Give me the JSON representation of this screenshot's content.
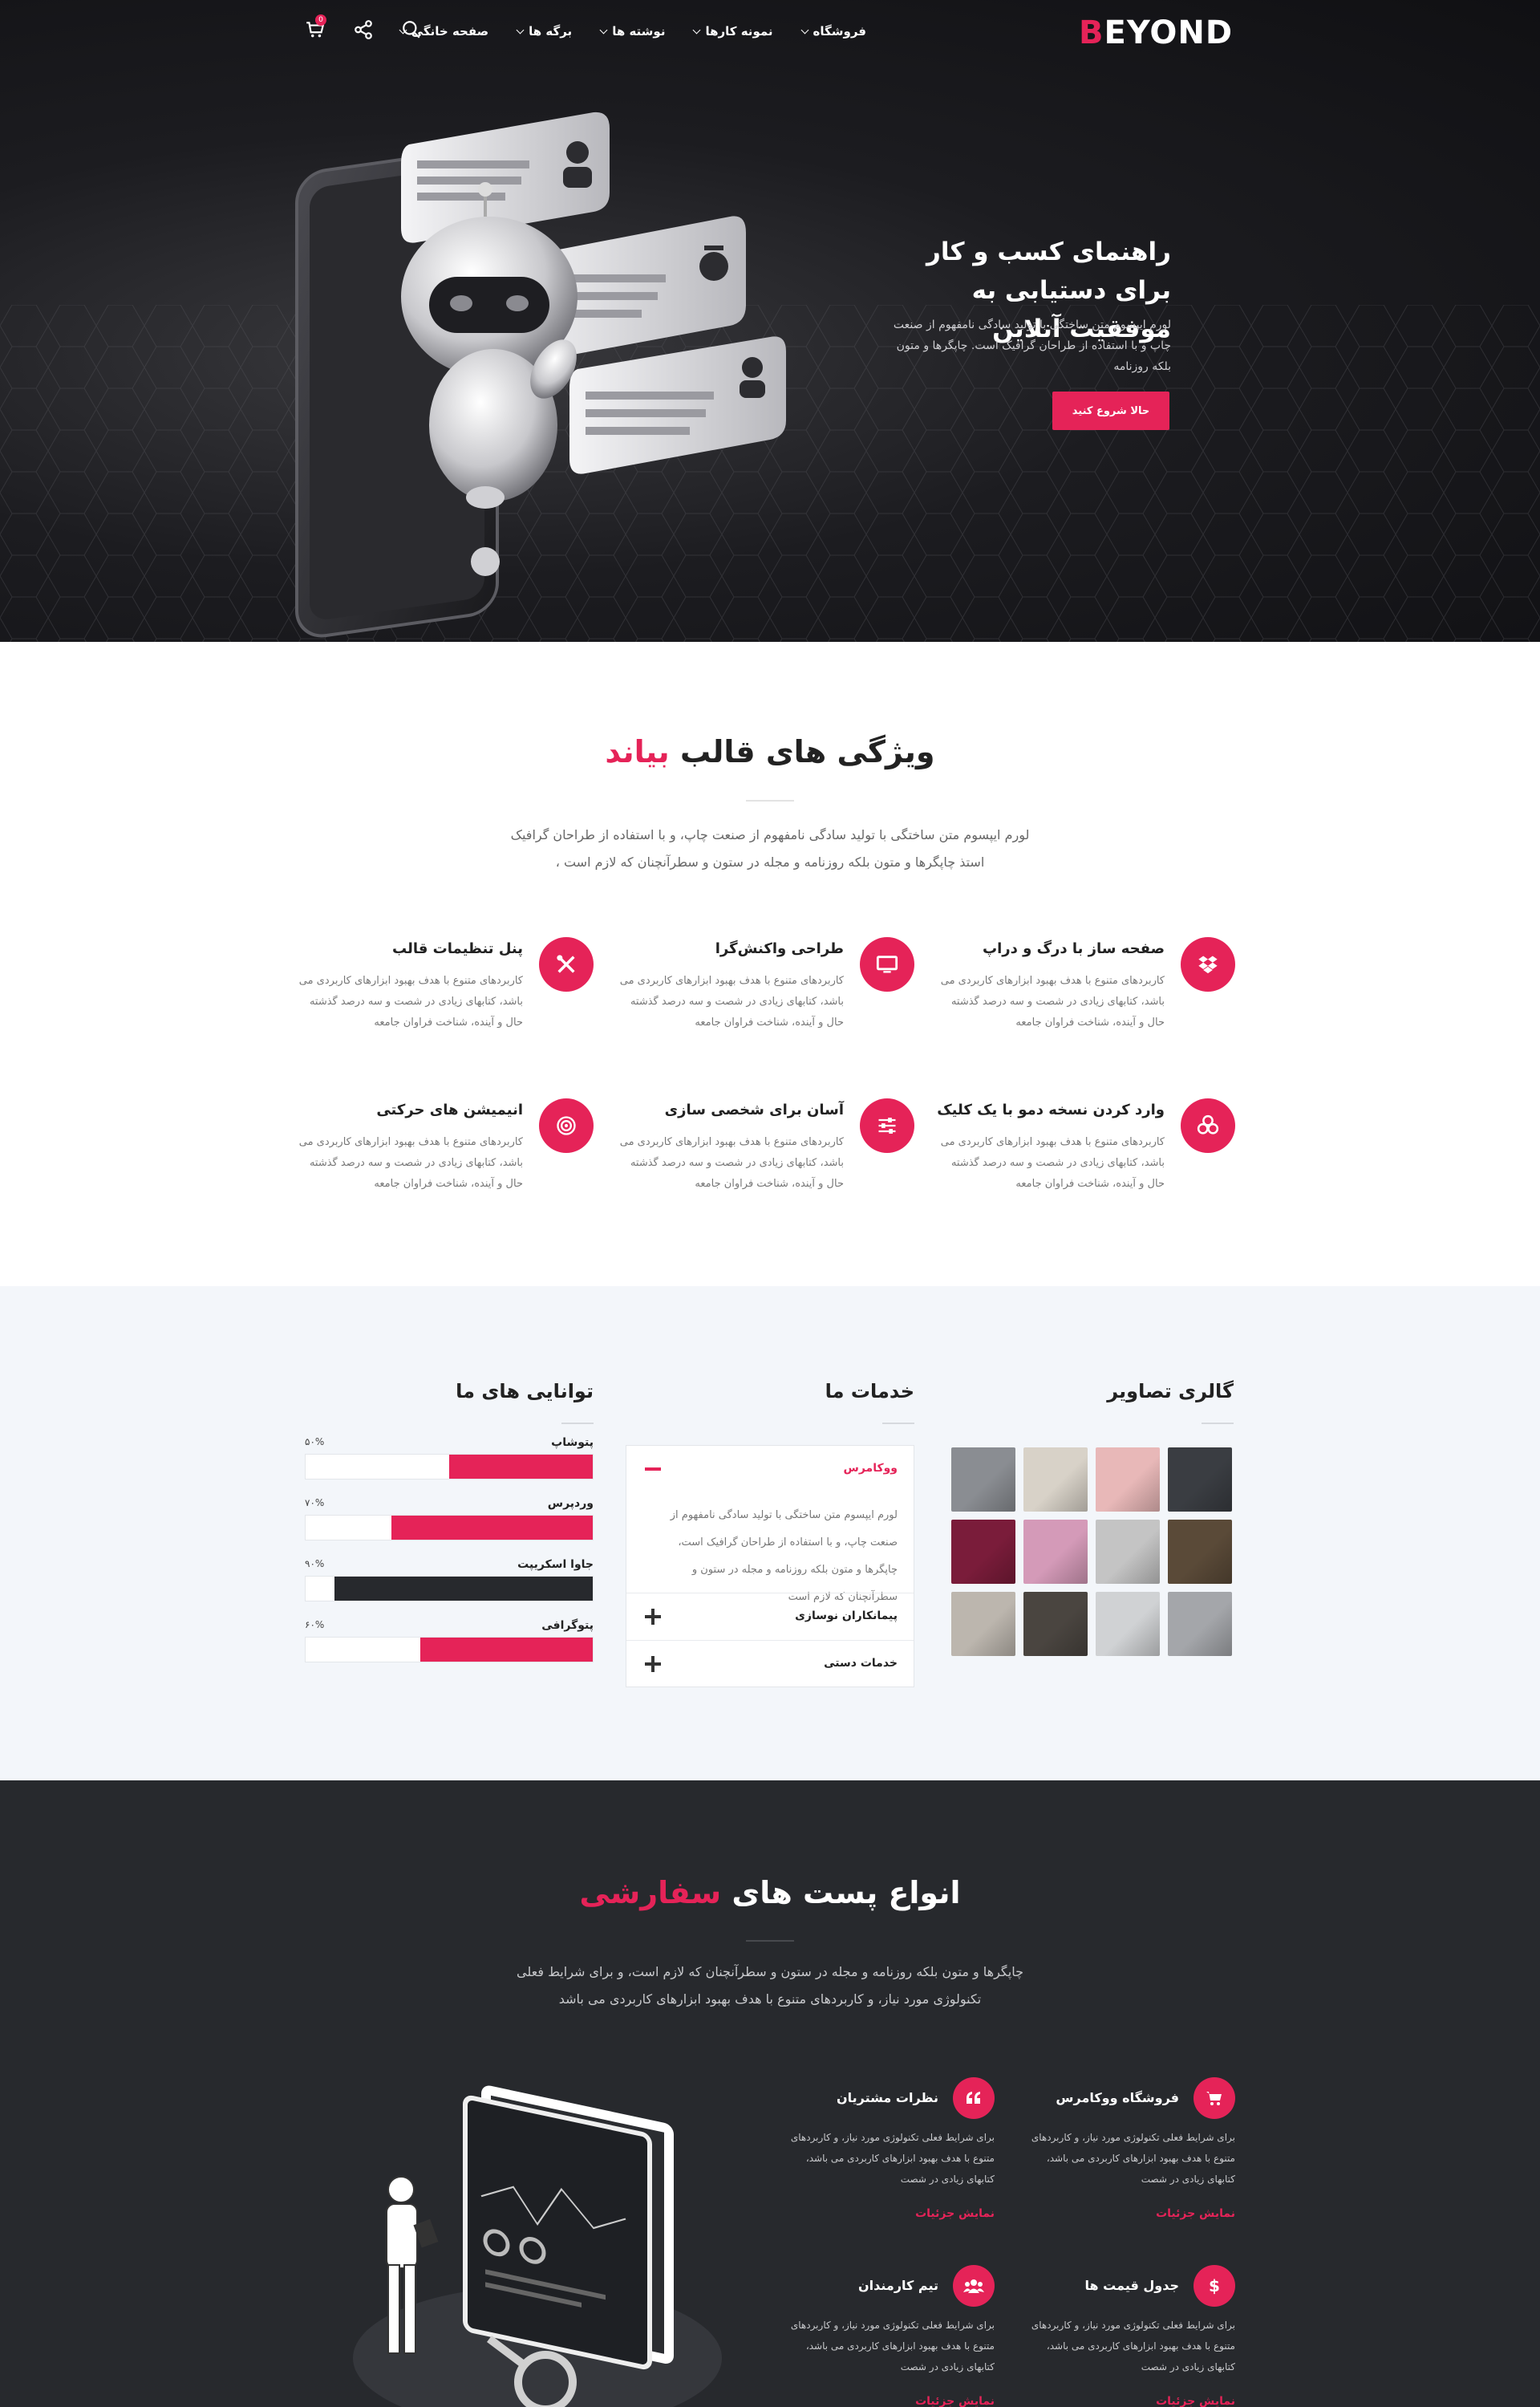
{
  "brand": {
    "logo": "BEYOND",
    "accent": "#e52358",
    "dark": "#27292d",
    "light_band": "#f3f6fa"
  },
  "nav": {
    "items": [
      {
        "label": "صفحه خانگی",
        "icon": "chevron-down-icon"
      },
      {
        "label": "برگه ها",
        "icon": "chevron-down-icon"
      },
      {
        "label": "نوشته ها",
        "icon": "chevron-down-icon"
      },
      {
        "label": "نمونه کارها",
        "icon": "chevron-down-icon"
      },
      {
        "label": "فروشگاه",
        "icon": "chevron-down-icon"
      }
    ],
    "icons": [
      "search-icon",
      "share-icon",
      "cart-icon"
    ],
    "cart_count": "0"
  },
  "hero": {
    "title": "راهنمای کسب و کار برای دستیابی به موفقیت آنلاین",
    "text": "لورم ایپسوم متن ساختگی با تولید سادگی نامفهوم از صنعت چاپ و با استفاده از طراحان گرافیک است. چاپگرها و متون بلکه روزنامه",
    "button": "حالا شروع کنید"
  },
  "features_section": {
    "title": "ویژگی های قالب",
    "title_accent": "بیاند",
    "desc": "لورم ایپسوم متن ساختگی با تولید سادگی نامفهوم از صنعت چاپ، و با استفاده از طراحان گرافیک استذ چاپگرها و متون بلکه روزنامه و مجله در ستون و سطرآنچنان که لازم است ،",
    "items": [
      {
        "title": "صفحه ساز با درگ و دراپ",
        "icon": "dropbox-icon",
        "text": "کاربردهای متنوع با هدف بهبود ابزارهای کاربردی می باشد، کتابهای زیادی در شصت و سه درصد گذشته حال و آینده، شناخت فراوان جامعه"
      },
      {
        "title": "طراحی واکنش‌گرا",
        "icon": "monitor-icon",
        "text": "کاربردهای متنوع با هدف بهبود ابزارهای کاربردی می باشد، کتابهای زیادی در شصت و سه درصد گذشته حال و آینده، شناخت فراوان جامعه"
      },
      {
        "title": "پنل تنظیمات قالب",
        "icon": "tools-icon",
        "text": "کاربردهای متنوع با هدف بهبود ابزارهای کاربردی می باشد، کتابهای زیادی در شصت و سه درصد گذشته حال و آینده، شناخت فراوان جامعه"
      },
      {
        "title": "وارد کردن نسخه دمو با یک کلیک",
        "icon": "cubes-icon",
        "text": "کاربردهای متنوع با هدف بهبود ابزارهای کاربردی می باشد، کتابهای زیادی در شصت و سه درصد گذشته حال و آینده، شناخت فراوان جامعه"
      },
      {
        "title": "آسان برای شخصی سازی",
        "icon": "sliders-icon",
        "text": "کاربردهای متنوع با هدف بهبود ابزارهای کاربردی می باشد، کتابهای زیادی در شصت و سه درصد گذشته حال و آینده، شناخت فراوان جامعه"
      },
      {
        "title": "انیمیشن های حرکتی",
        "icon": "target-icon",
        "text": "کاربردهای متنوع با هدف بهبود ابزارهای کاربردی می باشد، کتابهای زیادی در شصت و سه درصد گذشته حال و آینده، شناخت فراوان جامعه"
      }
    ]
  },
  "gallery": {
    "title": "گالری تصاویر",
    "images": [
      {
        "name": "tablet-photo",
        "color": "#3a3d42"
      },
      {
        "name": "pink-wall-photo",
        "color": "#e8b8b8"
      },
      {
        "name": "notebook-photo",
        "color": "#d8d2c8"
      },
      {
        "name": "cards-photo",
        "color": "#8a8d92"
      },
      {
        "name": "laptop-desk-photo",
        "color": "#5a4a38"
      },
      {
        "name": "laptop-photo",
        "color": "#c4c4c4"
      },
      {
        "name": "pink-book-photo",
        "color": "#d49ab8"
      },
      {
        "name": "red-portrait-photo",
        "color": "#7a1c3a"
      },
      {
        "name": "stationery-photo",
        "color": "#a4a6aa"
      },
      {
        "name": "desk-items-photo",
        "color": "#d0d2d4"
      },
      {
        "name": "dark-desk-photo",
        "color": "#4a4540"
      },
      {
        "name": "pencils-photo",
        "color": "#bcb6ae"
      }
    ]
  },
  "services": {
    "title": "خدمات ما",
    "items": [
      {
        "label": "ووکامرس",
        "open": true,
        "body": "لورم ایپسوم متن ساختگی با تولید سادگی نامفهوم از صنعت چاپ، و با استفاده از طراحان گرافیک است، چاپگرها و متون بلکه روزنامه و مجله در ستون و سطرآنچنان که لازم است"
      },
      {
        "label": "پیمانکاران نوسازی",
        "open": false
      },
      {
        "label": "خدمات دستی",
        "open": false
      }
    ]
  },
  "skills": {
    "title": "توانایی های ما",
    "items": [
      {
        "label": "پتوشاپ",
        "pct_text": "۵۰%",
        "value": 0.5,
        "color": "#e52358"
      },
      {
        "label": "وردپرس",
        "pct_text": "۷۰%",
        "value": 0.7,
        "color": "#e52358"
      },
      {
        "label": "جاوا اسکریپت",
        "pct_text": "۹۰%",
        "value": 0.9,
        "color": "#27292d"
      },
      {
        "label": "پتوگرافی",
        "pct_text": "۶۰%",
        "value": 0.6,
        "color": "#e52358"
      }
    ]
  },
  "posts_section": {
    "title": "انواع پست های",
    "title_accent": "سفارشی",
    "desc": "چاپگرها و متون بلکه روزنامه و مجله در ستون و سطرآنچنان که لازم است، و برای شرایط فعلی تکنولوژی مورد نیاز، و کاربردهای متنوع با هدف بهبود ابزارهای کاربردی می باشد",
    "items": [
      {
        "title": "فروشگاه ووکامرس",
        "icon": "cart-icon",
        "text": "برای شرایط فعلی تکنولوژی مورد نیاز، و کاربردهای متنوع با هدف بهبود ابزارهای کاربردی می باشد، کتابهای زیادی در شصت",
        "link": "نمایش جزئیات"
      },
      {
        "title": "نظرات مشتریان",
        "icon": "quote-icon",
        "text": "برای شرایط فعلی تکنولوژی مورد نیاز، و کاربردهای متنوع با هدف بهبود ابزارهای کاربردی می باشد، کتابهای زیادی در شصت",
        "link": "نمایش جزئیات"
      },
      {
        "title": "جدول قیمت ها",
        "icon": "dollar-icon",
        "text": "برای شرایط فعلی تکنولوژی مورد نیاز، و کاربردهای متنوع با هدف بهبود ابزارهای کاربردی می باشد، کتابهای زیادی در شصت",
        "link": "نمایش جزئیات"
      },
      {
        "title": "تیم کارمندان",
        "icon": "users-icon",
        "text": "برای شرایط فعلی تکنولوژی مورد نیاز، و کاربردهای متنوع با هدف بهبود ابزارهای کاربردی می باشد، کتابهای زیادی در شصت",
        "link": "نمایش جزئیات"
      }
    ]
  }
}
